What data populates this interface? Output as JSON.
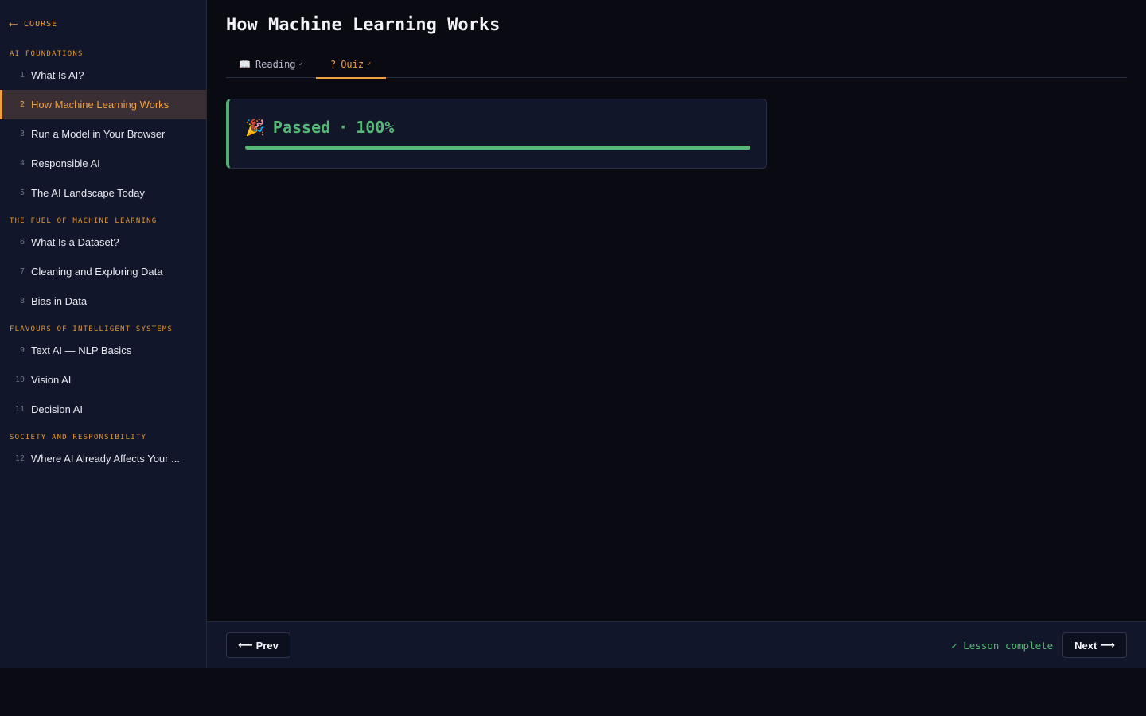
{
  "sidebar": {
    "back_label": "COURSE",
    "sections": [
      {
        "title": "AI FOUNDATIONS",
        "lessons": [
          {
            "num": "1",
            "label": "What Is AI?"
          },
          {
            "num": "2",
            "label": "How Machine Learning Works"
          },
          {
            "num": "3",
            "label": "Run a Model in Your Browser"
          },
          {
            "num": "4",
            "label": "Responsible AI"
          },
          {
            "num": "5",
            "label": "The AI Landscape Today"
          }
        ]
      },
      {
        "title": "THE FUEL OF MACHINE LEARNING",
        "lessons": [
          {
            "num": "6",
            "label": "What Is a Dataset?"
          },
          {
            "num": "7",
            "label": "Cleaning and Exploring Data"
          },
          {
            "num": "8",
            "label": "Bias in Data"
          }
        ]
      },
      {
        "title": "FLAVOURS OF INTELLIGENT SYSTEMS",
        "lessons": [
          {
            "num": "9",
            "label": "Text AI — NLP Basics"
          },
          {
            "num": "10",
            "label": "Vision AI"
          },
          {
            "num": "11",
            "label": "Decision AI"
          }
        ]
      },
      {
        "title": "SOCIETY AND RESPONSIBILITY",
        "lessons": [
          {
            "num": "12",
            "label": "Where AI Already Affects Your ..."
          }
        ]
      }
    ],
    "active_lesson": "2"
  },
  "header": {
    "title": "How Machine Learning Works",
    "tabs": [
      {
        "icon": "📖",
        "label": "Reading",
        "check": "✓"
      },
      {
        "icon": "?",
        "label": "Quiz",
        "check": "✓"
      }
    ]
  },
  "result": {
    "icon": "🎉",
    "status": "Passed",
    "separator": "·",
    "score": "100%",
    "progress_fraction": 1.0
  },
  "footer": {
    "prev_label": "Prev",
    "prev_arrow": "⟵",
    "status": "✓ Lesson complete",
    "next_label": "Next",
    "next_arrow": "⟶"
  },
  "colors": {
    "accent": "#f0a040",
    "success": "#56b877"
  }
}
